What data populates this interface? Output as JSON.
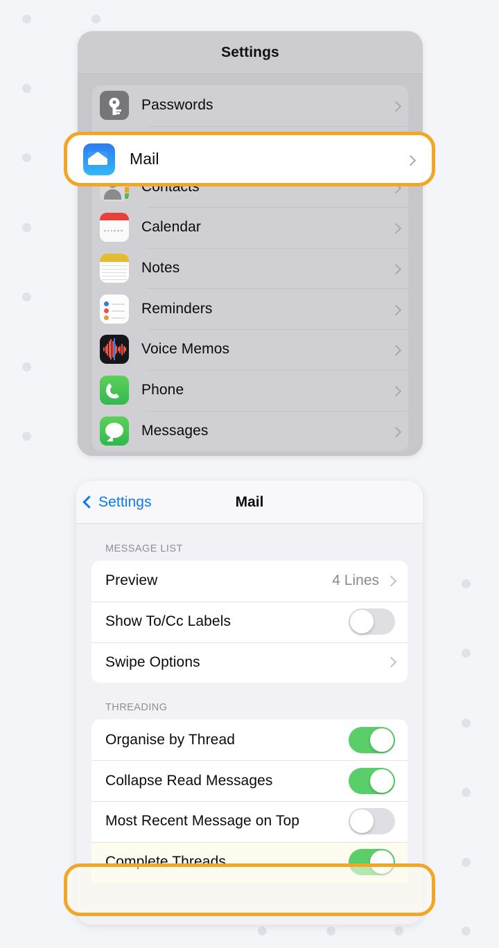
{
  "background": {
    "color": "#f4f5f8",
    "dot_color": "#dfe2e8"
  },
  "highlight": {
    "color": "#f2a626"
  },
  "settings_panel": {
    "title": "Settings",
    "rows": [
      {
        "label": "Passwords",
        "icon": "passwords-icon",
        "accessory": "chevron"
      },
      {
        "label": "Mail",
        "icon": "mail-icon",
        "accessory": "chevron",
        "highlighted": true
      },
      {
        "label": "Contacts",
        "icon": "contacts-icon",
        "accessory": "chevron"
      },
      {
        "label": "Calendar",
        "icon": "calendar-icon",
        "accessory": "chevron"
      },
      {
        "label": "Notes",
        "icon": "notes-icon",
        "accessory": "chevron"
      },
      {
        "label": "Reminders",
        "icon": "reminders-icon",
        "accessory": "chevron"
      },
      {
        "label": "Voice Memos",
        "icon": "voice-memos-icon",
        "accessory": "chevron"
      },
      {
        "label": "Phone",
        "icon": "phone-icon",
        "accessory": "chevron"
      },
      {
        "label": "Messages",
        "icon": "messages-icon",
        "accessory": "chevron"
      }
    ]
  },
  "mail_panel": {
    "back_label": "Settings",
    "title": "Mail",
    "sections": [
      {
        "header": "MESSAGE LIST",
        "rows": [
          {
            "label": "Preview",
            "type": "value",
            "value": "4 Lines"
          },
          {
            "label": "Show To/Cc Labels",
            "type": "toggle",
            "state": "off"
          },
          {
            "label": "Swipe Options",
            "type": "chevron"
          }
        ]
      },
      {
        "header": "THREADING",
        "rows": [
          {
            "label": "Organise by Thread",
            "type": "toggle",
            "state": "on"
          },
          {
            "label": "Collapse Read Messages",
            "type": "toggle",
            "state": "on"
          },
          {
            "label": "Most Recent Message on Top",
            "type": "toggle",
            "state": "off"
          },
          {
            "label": "Complete Threads",
            "type": "toggle",
            "state": "on",
            "highlighted": true
          }
        ]
      }
    ]
  },
  "toggle_colors": {
    "on": "#5ace68",
    "off": "#dfdfe3"
  }
}
